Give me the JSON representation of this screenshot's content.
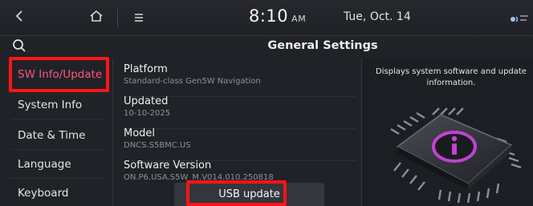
{
  "statusbar": {
    "time": "8:10",
    "ampm": "AM",
    "date": "Tue, Oct. 14",
    "back_icon": "back-chevron-icon",
    "home_icon": "home-icon",
    "menu_icon": "menu-lines-icon"
  },
  "header": {
    "title": "General Settings",
    "search_icon": "search-icon"
  },
  "sidebar": {
    "items": [
      {
        "label": "SW Info/Update",
        "active": true
      },
      {
        "label": "System Info",
        "active": false
      },
      {
        "label": "Date & Time",
        "active": false
      },
      {
        "label": "Language",
        "active": false
      },
      {
        "label": "Keyboard",
        "active": false
      }
    ]
  },
  "list": {
    "rows": [
      {
        "label": "Platform",
        "value": "Standard-class Gen5W Navigation"
      },
      {
        "label": "Updated",
        "value": "10-10-2025"
      },
      {
        "label": "Model",
        "value": "DNCS.S5BMC.US"
      },
      {
        "label": "Software Version",
        "value": "ON.P6.USA.S5W_M.V014.010.250818"
      }
    ],
    "usb_button": "USB update"
  },
  "info_panel": {
    "description": "Displays system software and update information.",
    "icon": "chip-info-icon"
  },
  "colors": {
    "accent_active": "#ff5678",
    "highlight": "#ff1414",
    "background": "#202228"
  }
}
